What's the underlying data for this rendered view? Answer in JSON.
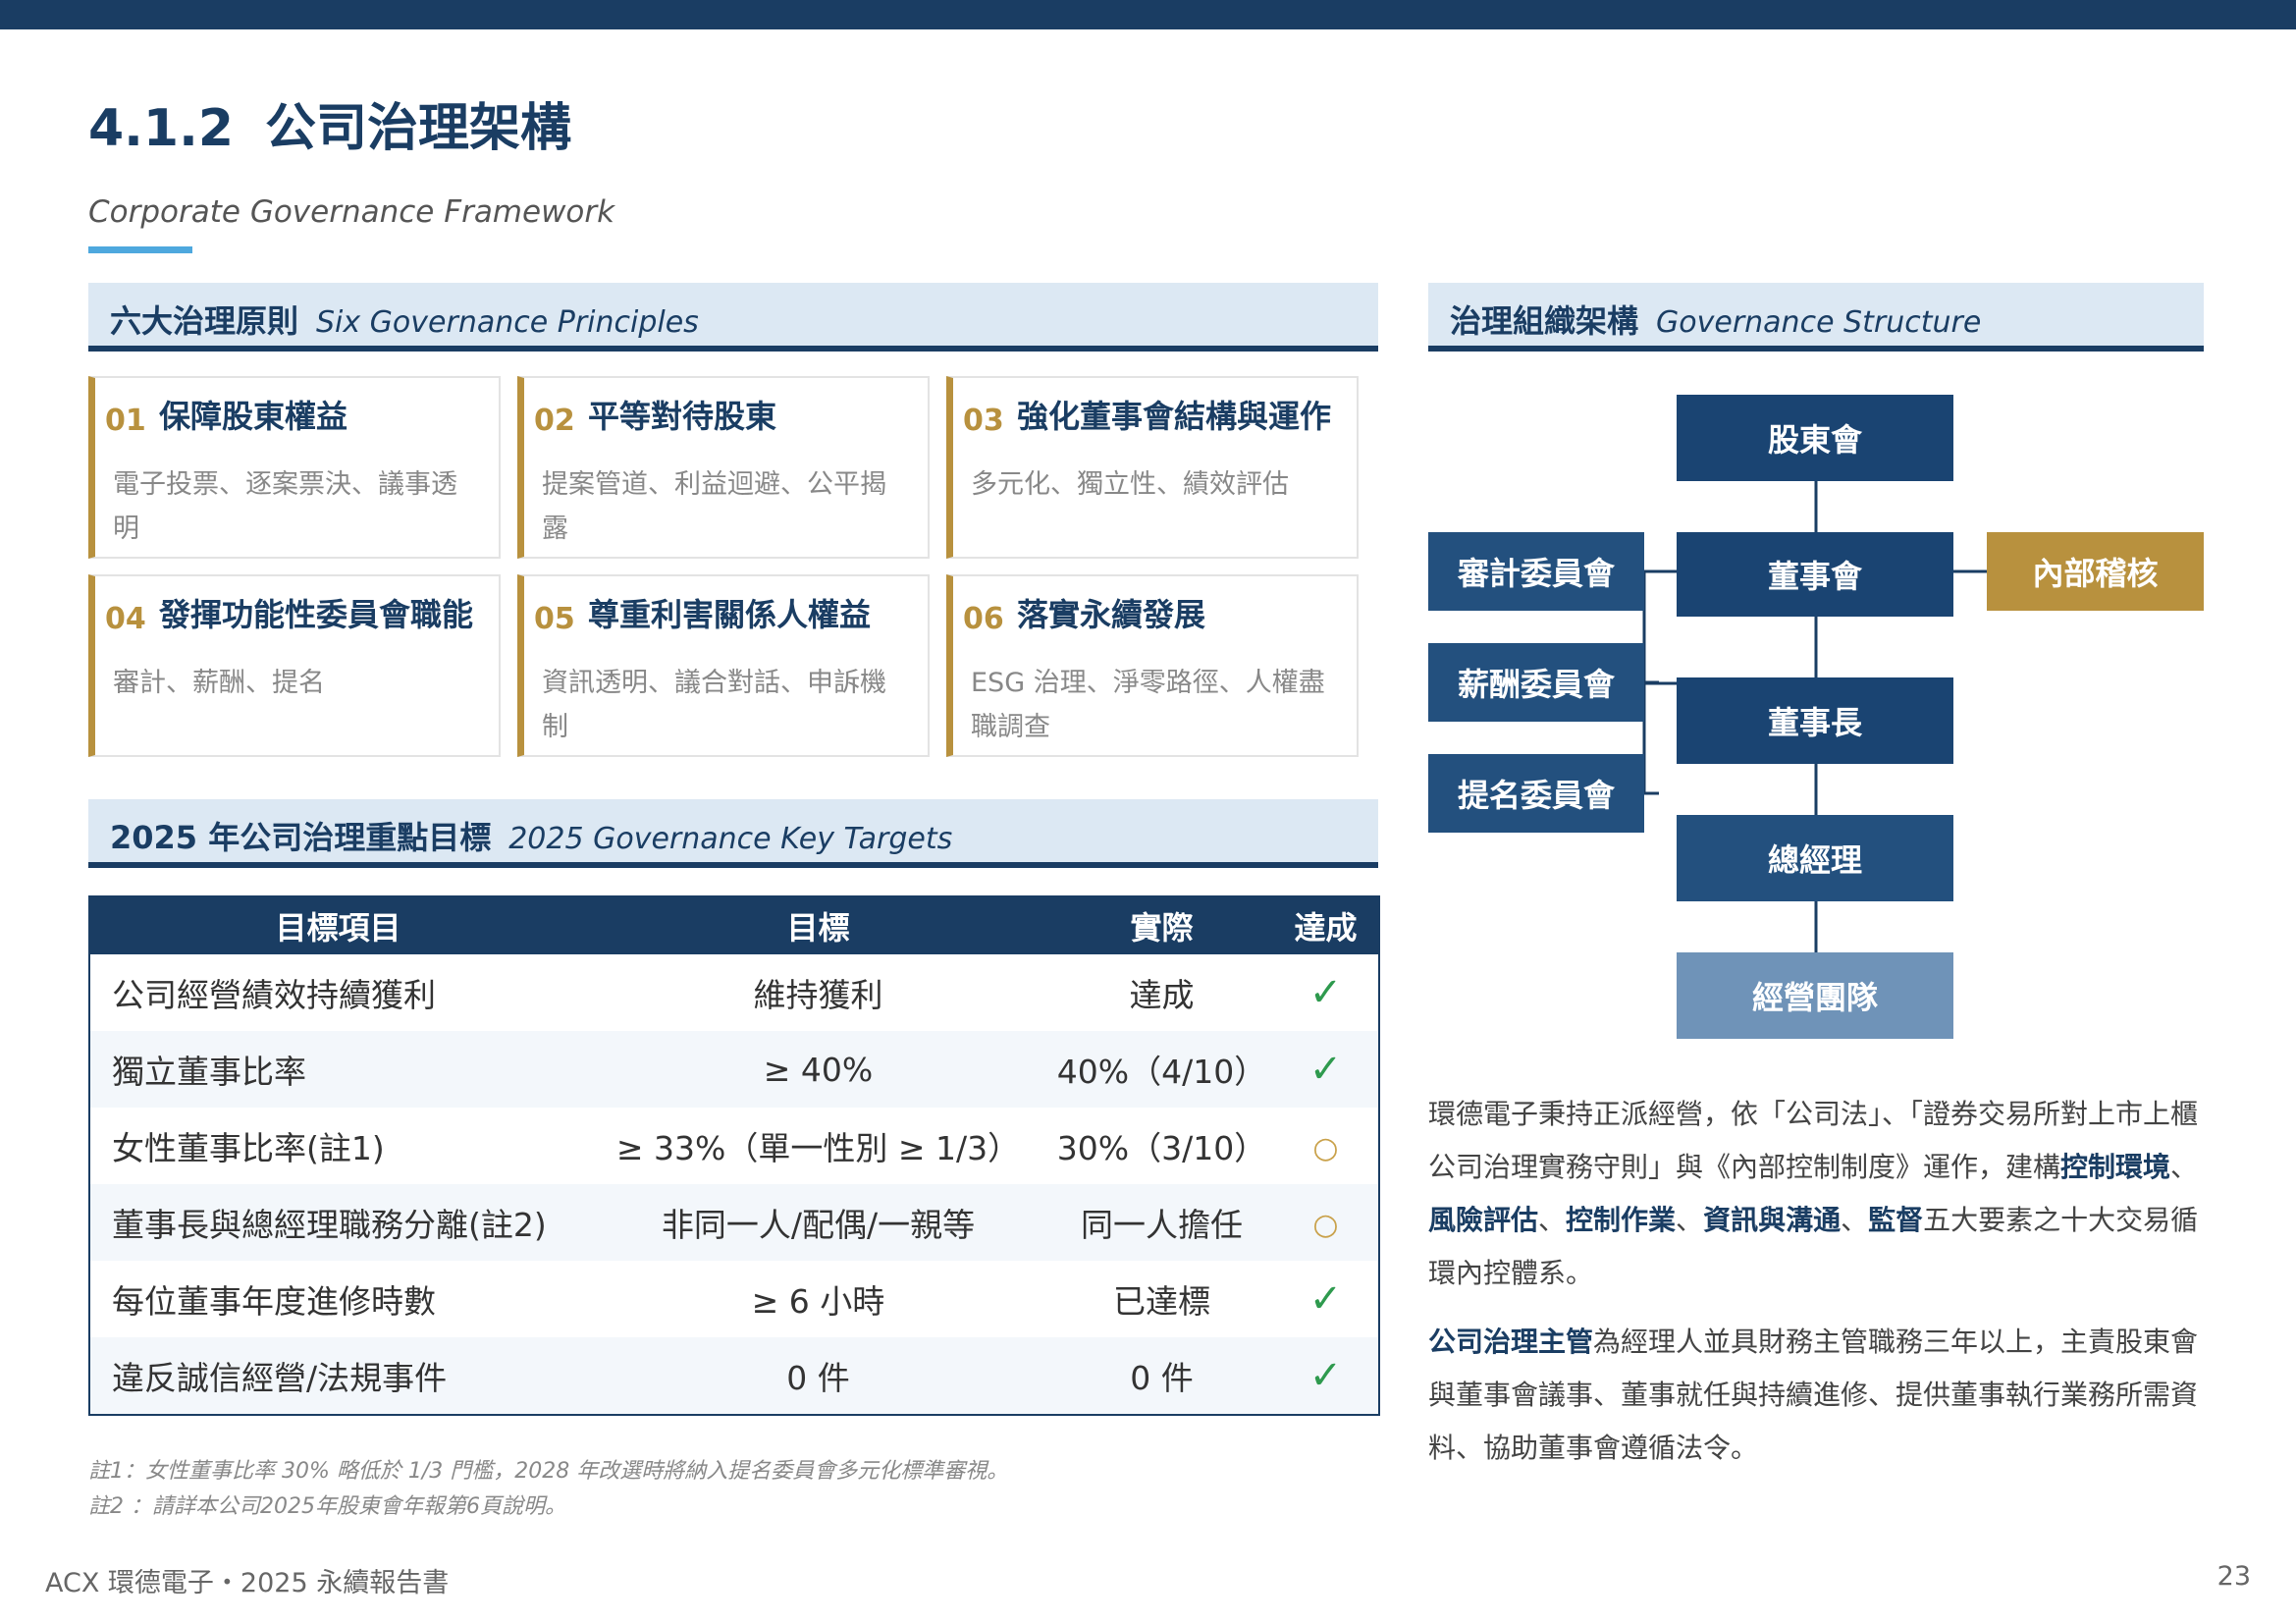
{
  "section_number": "4.1.2",
  "title": "公司治理架構",
  "subtitle": "Corporate Governance Framework",
  "principles_header": {
    "zh": "六大治理原則",
    "en": "Six Governance Principles"
  },
  "principles": [
    {
      "num": "01",
      "title": "保障股東權益",
      "desc": "電子投票、逐案票決、議事透明"
    },
    {
      "num": "02",
      "title": "平等對待股東",
      "desc": "提案管道、利益迴避、公平揭露"
    },
    {
      "num": "03",
      "title": "強化董事會結構與運作",
      "desc": "多元化、獨立性、績效評估"
    },
    {
      "num": "04",
      "title": "發揮功能性委員會職能",
      "desc": "審計、薪酬、提名"
    },
    {
      "num": "05",
      "title": "尊重利害關係人權益",
      "desc": "資訊透明、議合對話、申訴機制"
    },
    {
      "num": "06",
      "title": "落實永續發展",
      "desc": "ESG 治理、淨零路徑、人權盡職調查"
    }
  ],
  "targets_header": {
    "zh": "2025 年公司治理重點目標",
    "en": "2025 Governance Key Targets"
  },
  "targets_table": {
    "headers": [
      "目標項目",
      "目標",
      "實際",
      "達成"
    ],
    "rows": [
      {
        "item": "公司經營績效持續獲利",
        "target": "維持獲利",
        "actual": "達成",
        "status": "✓"
      },
      {
        "item": "獨立董事比率",
        "target": "≥ 40%",
        "actual": "40%（4/10）",
        "status": "✓"
      },
      {
        "item": "女性董事比率(註1)",
        "target": "≥ 33%（單一性別 ≥ 1/3）",
        "actual": "30%（3/10）",
        "status": "○"
      },
      {
        "item": "董事長與總經理職務分離(註2)",
        "target": "非同一人/配偶/一親等",
        "actual": "同一人擔任",
        "status": "○"
      },
      {
        "item": "每位董事年度進修時數",
        "target": "≥ 6 小時",
        "actual": "已達標",
        "status": "✓"
      },
      {
        "item": "違反誠信經營/法規事件",
        "target": "0 件",
        "actual": "0 件",
        "status": "✓"
      }
    ]
  },
  "notes": [
    "註1：女性董事比率 30% 略低於 1/3 門檻，2028 年改選時將納入提名委員會多元化標準審視。",
    "註2 ：請詳本公司2025年股東會年報第6頁說明。"
  ],
  "structure_header": {
    "zh": "治理組織架構",
    "en": "Governance Structure"
  },
  "org": {
    "shareholders": "股東會",
    "board": "董事會",
    "chairman": "董事長",
    "president": "總經理",
    "management": "經營團隊",
    "audit_committee": "審計委員會",
    "remuneration_committee": "薪酬委員會",
    "nomination_committee": "提名委員會",
    "internal_audit": "內部稽核"
  },
  "para1": {
    "t1": "環德電子秉持正派經營，依「公司法」、「證券交易所對上市上櫃公司治理實務守則」與《內部控制制度》運作，建構",
    "b1": "控制環境",
    "s1": "、",
    "b2": "風險評估",
    "s2": "、",
    "b3": "控制作業",
    "s3": "、",
    "b4": "資訊與溝通",
    "s4": "、",
    "b5": "監督",
    "t2": "五大要素之十大交易循環內控體系。"
  },
  "para2": {
    "b1": "公司治理主管",
    "t1": "為經理人並具財務主管職務三年以上，主責股東會與董事會議事、董事就任與持續進修、提供董事執行業務所需資料、協助董事會遵循法令。"
  },
  "footer": "ACX 環德電子・2025 永續報告書",
  "page_number": "23",
  "colors": {
    "navy": "#1a3d63",
    "gold": "#b8913e",
    "light_blue": "#dce8f3",
    "accent": "#4ea8de",
    "check": "#2e9a4e"
  }
}
